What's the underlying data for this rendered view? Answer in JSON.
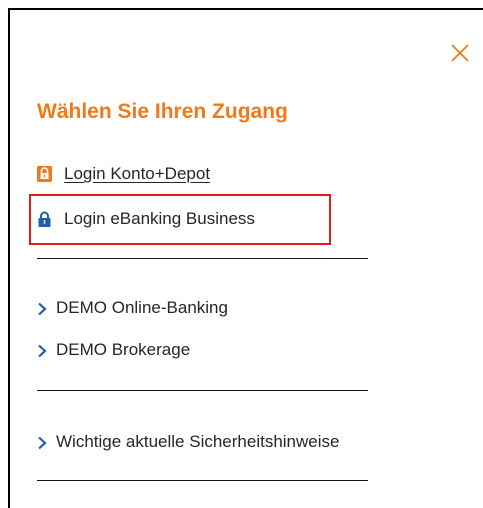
{
  "dialog": {
    "title": "Wählen Sie Ihren Zugang",
    "close_icon": "close-icon",
    "accent_color": "#f07a1a",
    "highlight_color": "#e31b23"
  },
  "login_links": [
    {
      "label": "Login Konto+Depot",
      "icon": "lock-icon",
      "icon_color": "#f07a1a"
    },
    {
      "label": "Login eBanking Business",
      "icon": "lock-icon",
      "icon_color": "#1f5ea8"
    }
  ],
  "demo_links": [
    {
      "label": "DEMO Online-Banking",
      "icon": "chevron-right-icon"
    },
    {
      "label": "DEMO Brokerage",
      "icon": "chevron-right-icon"
    }
  ],
  "info_links": [
    {
      "label": "Wichtige aktuelle Sicherheitshinweise",
      "icon": "chevron-right-icon"
    }
  ]
}
